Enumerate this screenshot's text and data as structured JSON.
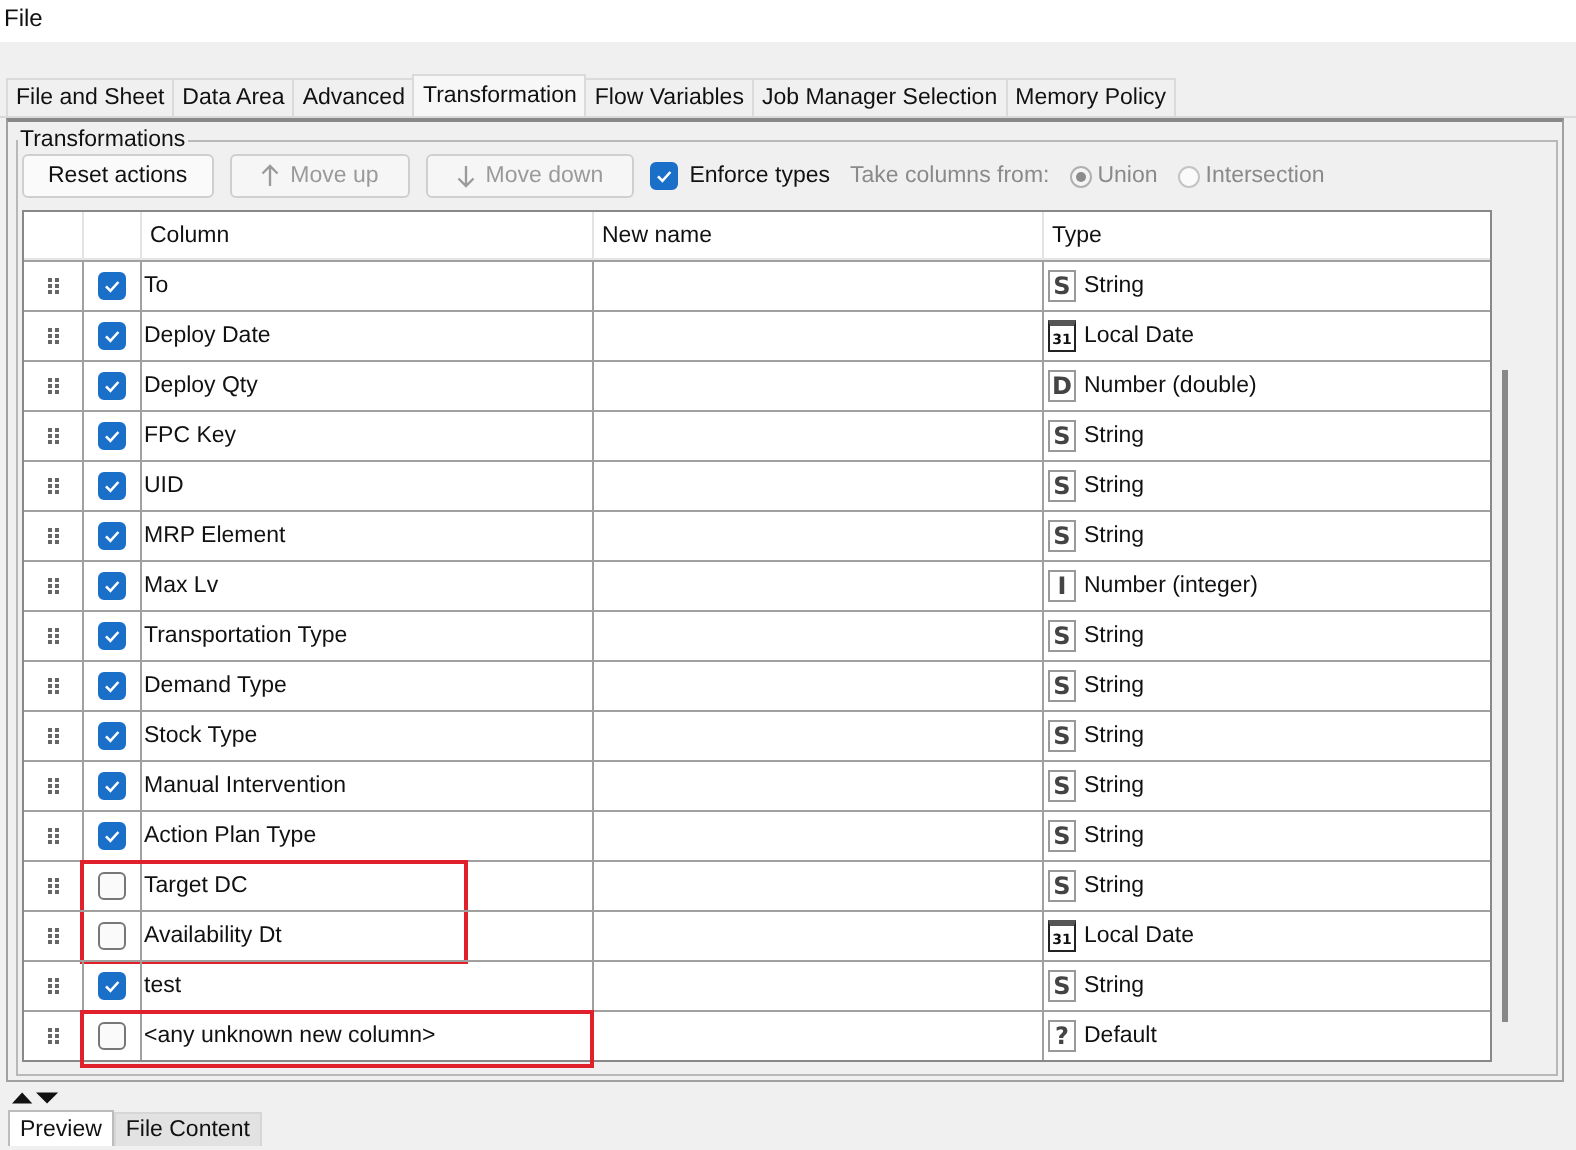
{
  "menu": [
    "File"
  ],
  "tabs": [
    {
      "label": "File and Sheet",
      "selected": false
    },
    {
      "label": "Data Area",
      "selected": false
    },
    {
      "label": "Advanced",
      "selected": false
    },
    {
      "label": "Transformation",
      "selected": true
    },
    {
      "label": "Flow Variables",
      "selected": false
    },
    {
      "label": "Job Manager Selection",
      "selected": false
    },
    {
      "label": "Memory Policy",
      "selected": false
    }
  ],
  "group_title": "Transformations",
  "toolbar": {
    "reset": {
      "label": "Reset actions",
      "disabled": false
    },
    "move_up": {
      "label": "Move up",
      "disabled": true
    },
    "move_down": {
      "label": "Move down",
      "disabled": true
    },
    "enforce_types": {
      "label": "Enforce types",
      "checked": true
    },
    "take_from": {
      "label": "Take columns from:",
      "disabled": true,
      "options": [
        {
          "label": "Union",
          "selected": true
        },
        {
          "label": "Intersection",
          "selected": false
        }
      ]
    }
  },
  "table": {
    "columns": [
      "Column",
      "New name",
      "Type"
    ],
    "rows": [
      {
        "checked": true,
        "column": "To",
        "type": {
          "kind": "letter",
          "icon": "S",
          "label": "String"
        },
        "highlight": false
      },
      {
        "checked": true,
        "column": "Deploy Date",
        "type": {
          "kind": "calendar",
          "icon": "31",
          "label": "Local Date"
        },
        "highlight": false
      },
      {
        "checked": true,
        "column": "Deploy Qty",
        "type": {
          "kind": "letter",
          "icon": "D",
          "label": "Number (double)"
        },
        "highlight": false
      },
      {
        "checked": true,
        "column": "FPC Key",
        "type": {
          "kind": "letter",
          "icon": "S",
          "label": "String"
        },
        "highlight": false
      },
      {
        "checked": true,
        "column": "UID",
        "type": {
          "kind": "letter",
          "icon": "S",
          "label": "String"
        },
        "highlight": false
      },
      {
        "checked": true,
        "column": "MRP Element",
        "type": {
          "kind": "letter",
          "icon": "S",
          "label": "String"
        },
        "highlight": false
      },
      {
        "checked": true,
        "column": "Max Lv",
        "type": {
          "kind": "letter",
          "icon": "I",
          "label": "Number (integer)"
        },
        "highlight": false
      },
      {
        "checked": true,
        "column": "Transportation Type",
        "type": {
          "kind": "letter",
          "icon": "S",
          "label": "String"
        },
        "highlight": false
      },
      {
        "checked": true,
        "column": "Demand Type",
        "type": {
          "kind": "letter",
          "icon": "S",
          "label": "String"
        },
        "highlight": false
      },
      {
        "checked": true,
        "column": "Stock Type",
        "type": {
          "kind": "letter",
          "icon": "S",
          "label": "String"
        },
        "highlight": false
      },
      {
        "checked": true,
        "column": "Manual Intervention",
        "type": {
          "kind": "letter",
          "icon": "S",
          "label": "String"
        },
        "highlight": false
      },
      {
        "checked": true,
        "column": "Action Plan Type",
        "type": {
          "kind": "letter",
          "icon": "S",
          "label": "String"
        },
        "highlight": false
      },
      {
        "checked": false,
        "column": "Target DC",
        "type": {
          "kind": "letter",
          "icon": "S",
          "label": "String"
        },
        "highlight": true
      },
      {
        "checked": false,
        "column": "Availability Dt",
        "type": {
          "kind": "calendar",
          "icon": "31",
          "label": "Local Date"
        },
        "highlight": true
      },
      {
        "checked": true,
        "column": "test",
        "type": {
          "kind": "letter",
          "icon": "S",
          "label": "String"
        },
        "highlight": false
      },
      {
        "checked": false,
        "column": "<any unknown new column>",
        "type": {
          "kind": "letter",
          "icon": "?",
          "label": "Default"
        },
        "highlight": true
      }
    ]
  },
  "bottom_tabs": [
    {
      "label": "Preview",
      "selected": true
    },
    {
      "label": "File Content",
      "selected": false
    }
  ]
}
